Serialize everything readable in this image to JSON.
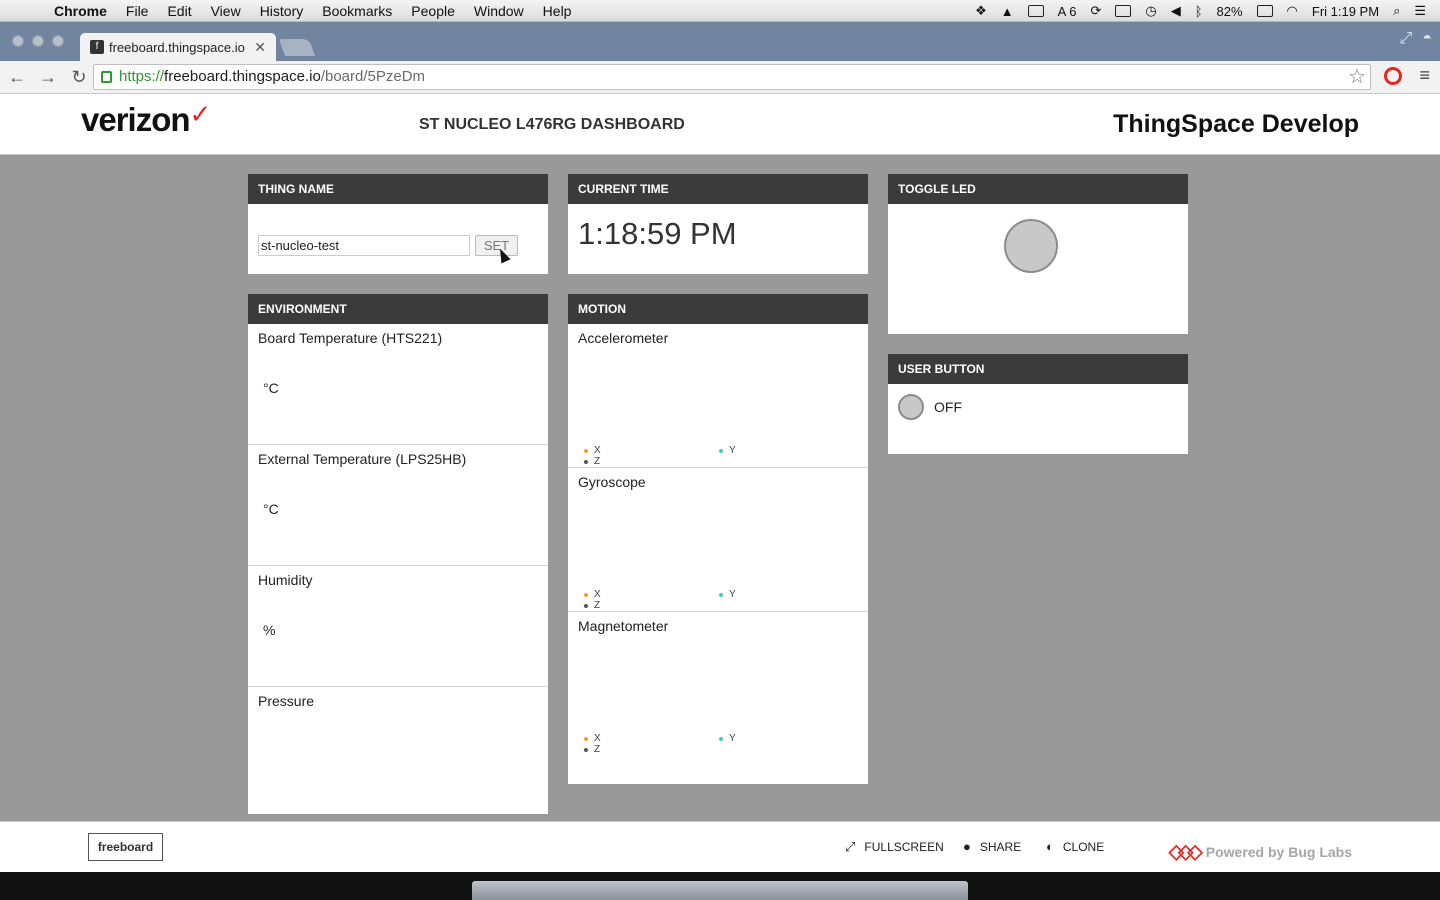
{
  "menubar": {
    "app": "Chrome",
    "items": [
      "File",
      "Edit",
      "View",
      "History",
      "Bookmarks",
      "People",
      "Window",
      "Help"
    ],
    "status": {
      "adobe_count": "6",
      "battery": "82%",
      "clock": "Fri 1:19 PM"
    }
  },
  "browser": {
    "tab_title": "freeboard.thingspace.io",
    "url_scheme": "https://",
    "url_host": "freeboard.thingspace.io",
    "url_path": "/board/5PzeDm"
  },
  "header": {
    "logo": "verizon",
    "logo_check": "✓",
    "title": "ST NUCLEO L476RG DASHBOARD",
    "brand": "ThingSpace Develop"
  },
  "panes": {
    "thing_name": {
      "title": "THING NAME",
      "input_value": "st-nucleo-test",
      "button": "SET"
    },
    "current_time": {
      "title": "CURRENT TIME",
      "value": "1:18:59 PM"
    },
    "toggle_led": {
      "title": "TOGGLE LED"
    },
    "environment": {
      "title": "ENVIRONMENT",
      "sections": [
        {
          "label": "Board Temperature (HTS221)",
          "unit": "°C"
        },
        {
          "label": "External Temperature (LPS25HB)",
          "unit": "°C"
        },
        {
          "label": "Humidity",
          "unit": "%"
        },
        {
          "label": "Pressure",
          "unit": ""
        }
      ]
    },
    "motion": {
      "title": "MOTION",
      "sections": [
        {
          "label": "Accelerometer"
        },
        {
          "label": "Gyroscope"
        },
        {
          "label": "Magnetometer"
        }
      ],
      "legend": {
        "x": "X",
        "y": "Y",
        "z": "Z"
      },
      "colors": {
        "x": "#f0a030",
        "y": "#3ad0c0",
        "z": "#555555"
      }
    },
    "user_button": {
      "title": "USER BUTTON",
      "state": "OFF"
    }
  },
  "footer": {
    "badge": "freeboard",
    "fullscreen": "FULLSCREEN",
    "share": "SHARE",
    "clone": "CLONE",
    "powered_by": "Powered by Bug Labs"
  }
}
